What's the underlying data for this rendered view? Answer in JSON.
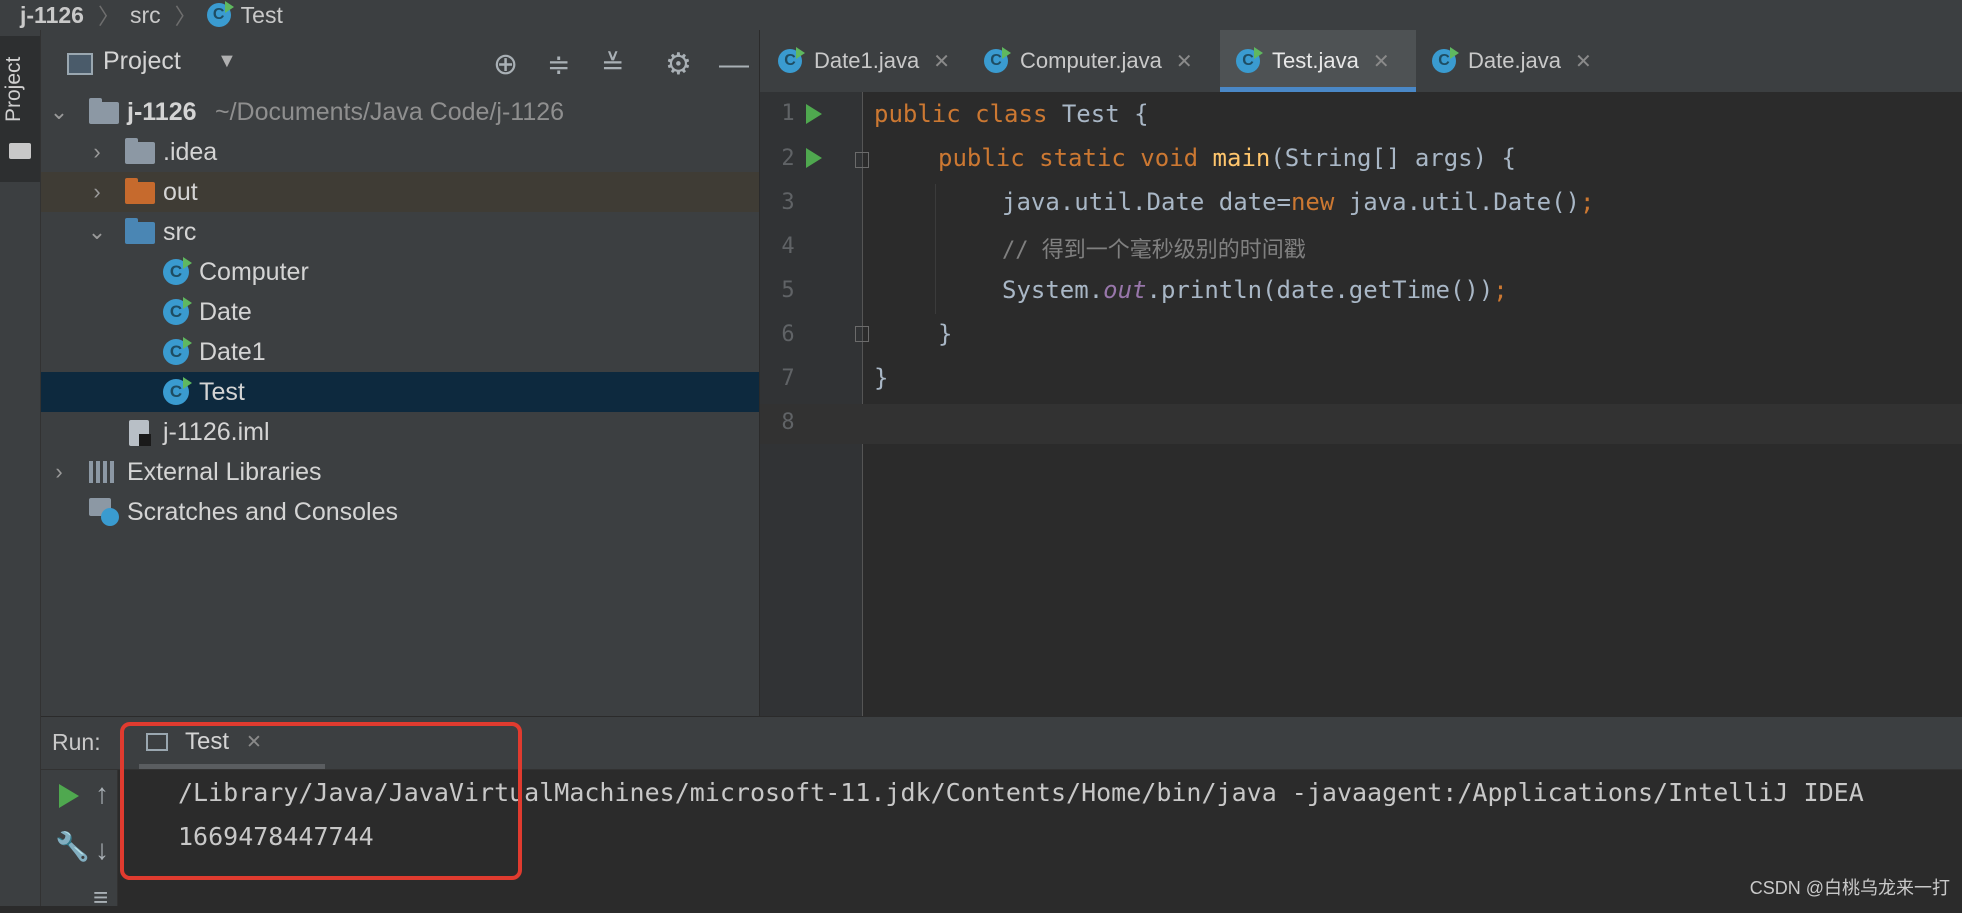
{
  "breadcrumb": {
    "project": "j-1126",
    "folder": "src",
    "file": "Test"
  },
  "left_stripe": {
    "project_label": "Project"
  },
  "project_panel": {
    "title": "Project",
    "tree": {
      "root_name": "j-1126",
      "root_path": "~/Documents/Java Code/j-1126",
      "idea": ".idea",
      "out": "out",
      "src": "src",
      "classes": [
        "Computer",
        "Date",
        "Date1",
        "Test"
      ],
      "iml": "j-1126.iml",
      "external_libraries": "External Libraries",
      "scratches": "Scratches and Consoles"
    }
  },
  "editor": {
    "tabs": [
      "Date1.java",
      "Computer.java",
      "Test.java",
      "Date.java"
    ],
    "active_tab": "Test.java",
    "line_numbers": [
      "1",
      "2",
      "3",
      "4",
      "5",
      "6",
      "7",
      "8"
    ],
    "code": {
      "l1_kw": "public class ",
      "l1_rest": "Test {",
      "l2_kw": "public static void ",
      "l2_fn": "main",
      "l2_rest": "(String[] args) {",
      "l3_a": "java.util.Date date=",
      "l3_kw": "new ",
      "l3_b": "java.util.Date()",
      "l3_semi": ";",
      "l4_comment": "// 得到一个毫秒级别的时间戳",
      "l5_a": "System.",
      "l5_field": "out",
      "l5_b": ".println(date.getTime())",
      "l5_semi": ";",
      "l6": "}",
      "l7": "}"
    }
  },
  "run_panel": {
    "label": "Run:",
    "tab": "Test",
    "console_lines": [
      "/Library/Java/JavaVirtualMachines/microsoft-11.jdk/Contents/Home/bin/java -javaagent:/Applications/IntelliJ IDEA",
      "1669478447744"
    ]
  },
  "watermark": "CSDN @白桃乌龙来一打",
  "colors": {
    "highlight_box": "#e03b2f",
    "keyword": "#cc7832",
    "accent": "#4a88c7"
  }
}
